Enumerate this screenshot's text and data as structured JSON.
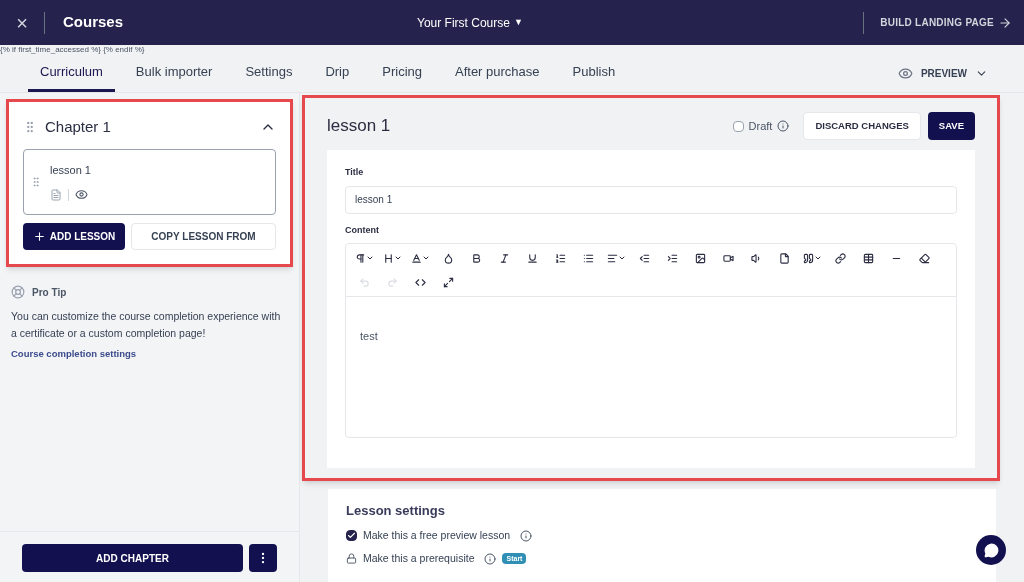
{
  "topbar": {
    "close": "×",
    "title": "Courses",
    "course": "Your First Course",
    "caret": "▼",
    "landing": "BUILD LANDING PAGE"
  },
  "template_text": "{% if first_time_accessed %} {% endif %}",
  "tabs": [
    {
      "label": "Curriculum",
      "selected": true
    },
    {
      "label": "Bulk importer",
      "selected": false
    },
    {
      "label": "Settings",
      "selected": false
    },
    {
      "label": "Drip",
      "selected": false
    },
    {
      "label": "Pricing",
      "selected": false
    },
    {
      "label": "After purchase",
      "selected": false
    },
    {
      "label": "Publish",
      "selected": false
    }
  ],
  "preview": "PREVIEW",
  "sidebar": {
    "chapter": {
      "title": "Chapter 1",
      "expanded": true,
      "highlighted": true,
      "lessons": [
        {
          "title": "lesson 1",
          "selected": true
        }
      ],
      "add_lesson": "ADD LESSON",
      "copy_lesson": "COPY LESSON FROM"
    },
    "pro_tip": {
      "heading": "Pro Tip",
      "text": "You can customize the course completion experience with a certificate or a custom completion page!",
      "link": "Course completion settings"
    },
    "add_chapter": "ADD CHAPTER"
  },
  "editor": {
    "highlighted": true,
    "heading": "lesson 1",
    "draft": {
      "label": "Draft",
      "checked": false
    },
    "discard": "DISCARD CHANGES",
    "save": "SAVE",
    "title_label": "Title",
    "title_value": "lesson 1",
    "content_label": "Content",
    "content": "test",
    "toolbar": [
      {
        "kind": "paragraph",
        "dropdown": true,
        "disabled": false
      },
      {
        "kind": "size",
        "dropdown": true,
        "disabled": false
      },
      {
        "kind": "font",
        "dropdown": true,
        "disabled": false
      },
      {
        "kind": "color",
        "dropdown": false,
        "disabled": false
      },
      {
        "kind": "bold",
        "dropdown": false,
        "disabled": false
      },
      {
        "kind": "italic",
        "dropdown": false,
        "disabled": false
      },
      {
        "kind": "underline",
        "dropdown": false,
        "disabled": false
      },
      {
        "kind": "ordered",
        "dropdown": false,
        "disabled": false
      },
      {
        "kind": "bullets",
        "dropdown": false,
        "disabled": false
      },
      {
        "kind": "align",
        "dropdown": true,
        "disabled": false
      },
      {
        "kind": "outdent",
        "dropdown": false,
        "disabled": false
      },
      {
        "kind": "indent",
        "dropdown": false,
        "disabled": false
      },
      {
        "kind": "image",
        "dropdown": false,
        "disabled": false
      },
      {
        "kind": "video",
        "dropdown": false,
        "disabled": false
      },
      {
        "kind": "audio",
        "dropdown": false,
        "disabled": false
      },
      {
        "kind": "file",
        "dropdown": false,
        "disabled": false
      },
      {
        "kind": "quote",
        "dropdown": true,
        "disabled": false
      },
      {
        "kind": "link",
        "dropdown": false,
        "disabled": false
      },
      {
        "kind": "table",
        "dropdown": false,
        "disabled": false
      },
      {
        "kind": "rule",
        "dropdown": false,
        "disabled": false
      },
      {
        "kind": "eraser",
        "dropdown": false,
        "disabled": false
      },
      {
        "kind": "undo",
        "dropdown": false,
        "disabled": true
      },
      {
        "kind": "redo",
        "dropdown": false,
        "disabled": true
      },
      {
        "kind": "code",
        "dropdown": false,
        "disabled": false
      },
      {
        "kind": "fullscreen",
        "dropdown": false,
        "disabled": false
      }
    ]
  },
  "lesson_settings": {
    "heading": "Lesson settings",
    "options": [
      {
        "kind": "checkbox",
        "label": "Make this a free preview lesson",
        "checked": true
      },
      {
        "kind": "locked",
        "label": "Make this a prerequisite",
        "badge": "Start"
      }
    ]
  }
}
